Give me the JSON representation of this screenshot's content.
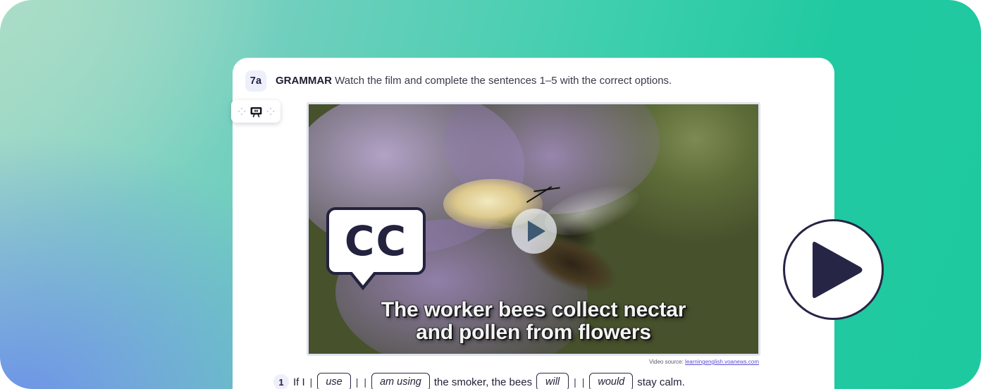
{
  "background": {
    "gradient_from": "#a9ddc6",
    "gradient_mid": "#6d93e8",
    "gradient_to": "#1fc9a0"
  },
  "toolbar": {
    "move_left_icon": "move-arrows-icon",
    "board_icon": "presentation-board-icon",
    "move_right_icon": "move-arrows-icon"
  },
  "exercise": {
    "number": "7a",
    "label": "GRAMMAR",
    "instruction": " Watch the film and complete the sentences 1–5 with the correct options."
  },
  "video": {
    "cc_label": "CC",
    "play_icon": "play-icon",
    "subtitle_line1": "The worker bees collect nectar",
    "subtitle_line2": "and pollen from flowers",
    "source_prefix": "Video source: ",
    "source_url": "learningenglish.voanews.com"
  },
  "sentences": [
    {
      "number": "1",
      "before": "If I",
      "options_a": [
        "use",
        "am using"
      ],
      "middle": "the smoker, the bees",
      "options_b": [
        "will",
        "would"
      ],
      "after": "stay calm.",
      "separator": "|"
    }
  ],
  "big_play_button": {
    "icon": "play-icon",
    "border_color": "#262546",
    "fill_color": "#262546"
  }
}
